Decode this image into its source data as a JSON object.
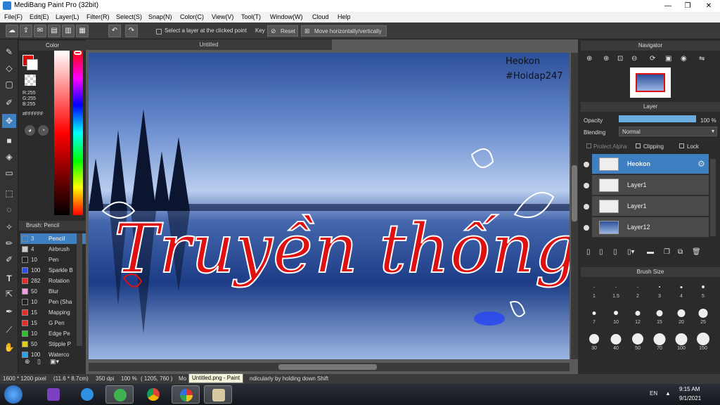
{
  "window": {
    "title": "MediBang Paint Pro (32bit)",
    "min": "—",
    "max": "❐",
    "close": "✕"
  },
  "menu": [
    "File(F)",
    "Edit(E)",
    "Layer(L)",
    "Filter(R)",
    "Select(S)",
    "Snap(N)",
    "Color(C)",
    "View(V)",
    "Tool(T)",
    "Window(W)",
    "Cloud",
    "Help"
  ],
  "toolbar": {
    "select_layer_label": "Select a layer at the clicked point",
    "key_label": "Key",
    "reset_label": "Reset",
    "move_label": "Move horizontally/vertically"
  },
  "color_panel": {
    "title": "Color",
    "r": "R:255",
    "g": "G:255",
    "b": "B:255",
    "hex": "#FFFFFF",
    "primary": "#e00000",
    "secondary": "#ffffff"
  },
  "brush_panel": {
    "title": "Brush: Pencil",
    "items": [
      {
        "size": "3",
        "name": "Pencil",
        "color": "#3d7fc0"
      },
      {
        "size": "4",
        "name": "Airbrush",
        "color": "#cccccc"
      },
      {
        "size": "10",
        "name": "Pen",
        "color": "#222222"
      },
      {
        "size": "100",
        "name": "Sparkle B",
        "color": "#3050e0"
      },
      {
        "size": "282",
        "name": "Rotation",
        "color": "#e03030"
      },
      {
        "size": "50",
        "name": "Blur",
        "color": "#f0a0e0"
      },
      {
        "size": "10",
        "name": "Pen (Sha",
        "color": "#222222"
      },
      {
        "size": "15",
        "name": "Mapping",
        "color": "#e03030"
      },
      {
        "size": "15",
        "name": "G Pen",
        "color": "#e03030"
      },
      {
        "size": "10",
        "name": "Edge Pe",
        "color": "#30c030"
      },
      {
        "size": "50",
        "name": "Stipple P",
        "color": "#e0d020"
      },
      {
        "size": "100",
        "name": "Waterco",
        "color": "#30a0e0"
      }
    ]
  },
  "document": {
    "tab": "Untitled",
    "text_line1": "Heokon",
    "text_line2": "#Hoidap247",
    "title_text": "Truyền thống"
  },
  "navigator": {
    "title": "Navigator"
  },
  "layer_panel": {
    "title": "Layer",
    "opacity_label": "Opacity",
    "opacity_value": "100 %",
    "opacity": 1.0,
    "blending_label": "Blending",
    "blending_value": "Normal",
    "protect_alpha": "Protect Alpha",
    "clipping": "Clipping",
    "lock": "Lock",
    "layers": [
      {
        "name": "Heokon",
        "selected": true
      },
      {
        "name": "Layer1",
        "selected": false
      },
      {
        "name": "Layer1",
        "selected": false
      },
      {
        "name": "Layer12",
        "selected": false
      }
    ]
  },
  "brush_size": {
    "title": "Brush Size",
    "sizes": [
      "1",
      "1.5",
      "2",
      "3",
      "4",
      "5",
      "7",
      "10",
      "12",
      "15",
      "20",
      "25",
      "30",
      "40",
      "50",
      "70",
      "100",
      "150"
    ]
  },
  "status": {
    "dims": "1600 * 1200 pixel",
    "cm": "(11.6 * 8.7cm)",
    "dpi": "350 dpi",
    "zoom": "100 %",
    "coords": "( 1205, 760 )",
    "hint": "Mo",
    "hint2": "ndicularly by holding down Shift"
  },
  "tooltip": "Untitled.png - Paint",
  "taskbar": {
    "lang": "EN",
    "time": "9:15 AM",
    "date": "9/1/2021"
  }
}
